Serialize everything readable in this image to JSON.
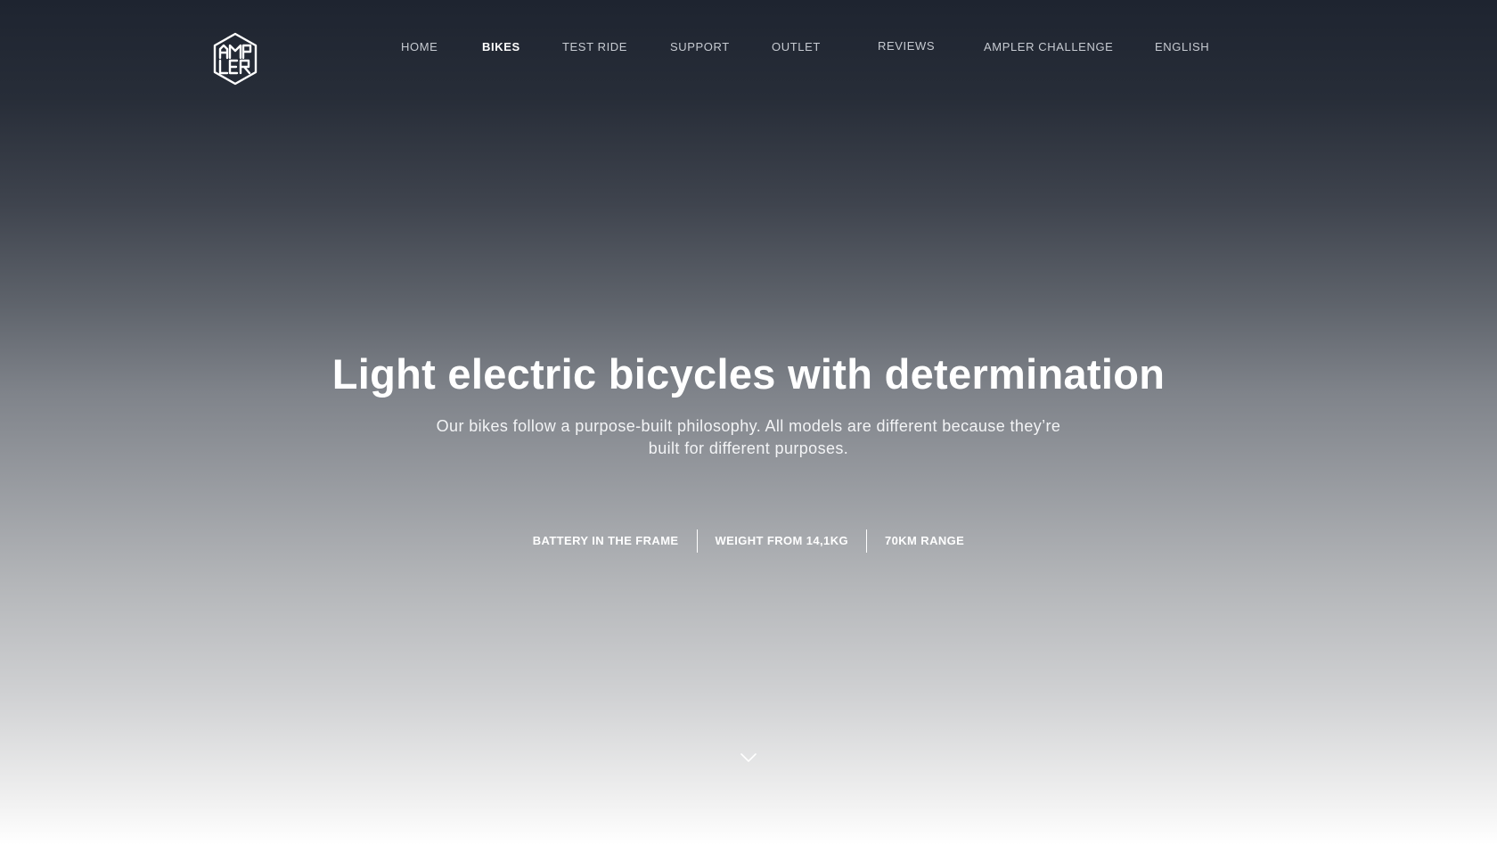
{
  "brand": {
    "logo_icon": "ampler-hexagon-logo-icon",
    "logo_letters": "AMPLER"
  },
  "nav": {
    "items": [
      {
        "label": "HOME",
        "active": false
      },
      {
        "label": "BIKES",
        "active": true
      },
      {
        "label": "TEST RIDE",
        "active": false
      },
      {
        "label": "SUPPORT",
        "active": false
      },
      {
        "label": "OUTLET",
        "active": false
      },
      {
        "label": "REVIEWS",
        "active": false
      },
      {
        "label": "AMPLER CHALLENGE",
        "active": false
      },
      {
        "label": "ENGLISH",
        "active": false
      }
    ]
  },
  "hero": {
    "title": "Light electric bicycles with determination",
    "subtitle": "Our bikes follow a purpose-built philosophy. All models are different because they’re built for different purposes.",
    "features": [
      "BATTERY IN THE FRAME",
      "WEIGHT FROM 14,1KG",
      "70KM RANGE"
    ]
  },
  "scroll": {
    "icon": "chevron-down-icon"
  },
  "colors": {
    "background_top": "#1e2430",
    "background_bottom": "#ffffff",
    "text": "#ffffff",
    "nav_text": "#c7cbd2"
  }
}
